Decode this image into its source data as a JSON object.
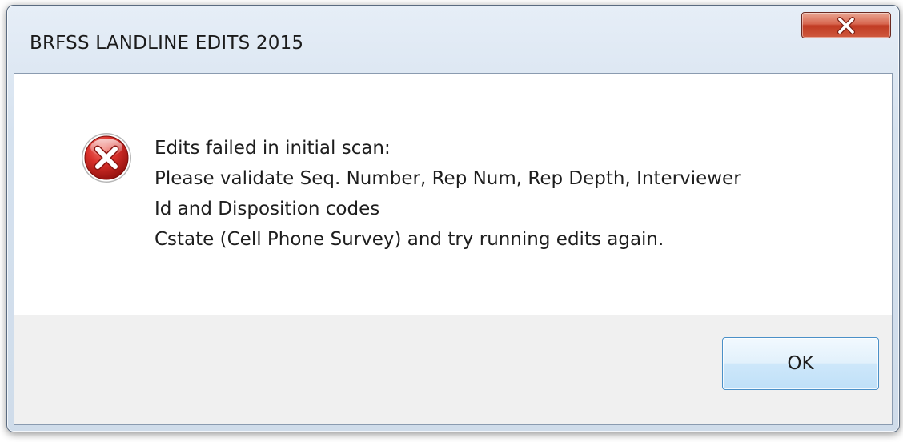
{
  "dialog": {
    "title": "BRFSS LANDLINE EDITS 2015",
    "close_icon": "close-x-icon",
    "icon": "error-icon",
    "message_lines": [
      "Edits failed in initial scan:",
      "Please validate Seq. Number, Rep Num, Rep Depth, Interviewer",
      "Id and Disposition codes",
      "Cstate (Cell Phone Survey) and try running edits again."
    ],
    "ok_label": "OK"
  },
  "colors": {
    "error_red": "#c8201c",
    "close_button_red": "#c03a22",
    "ok_border": "#4a90c8"
  }
}
